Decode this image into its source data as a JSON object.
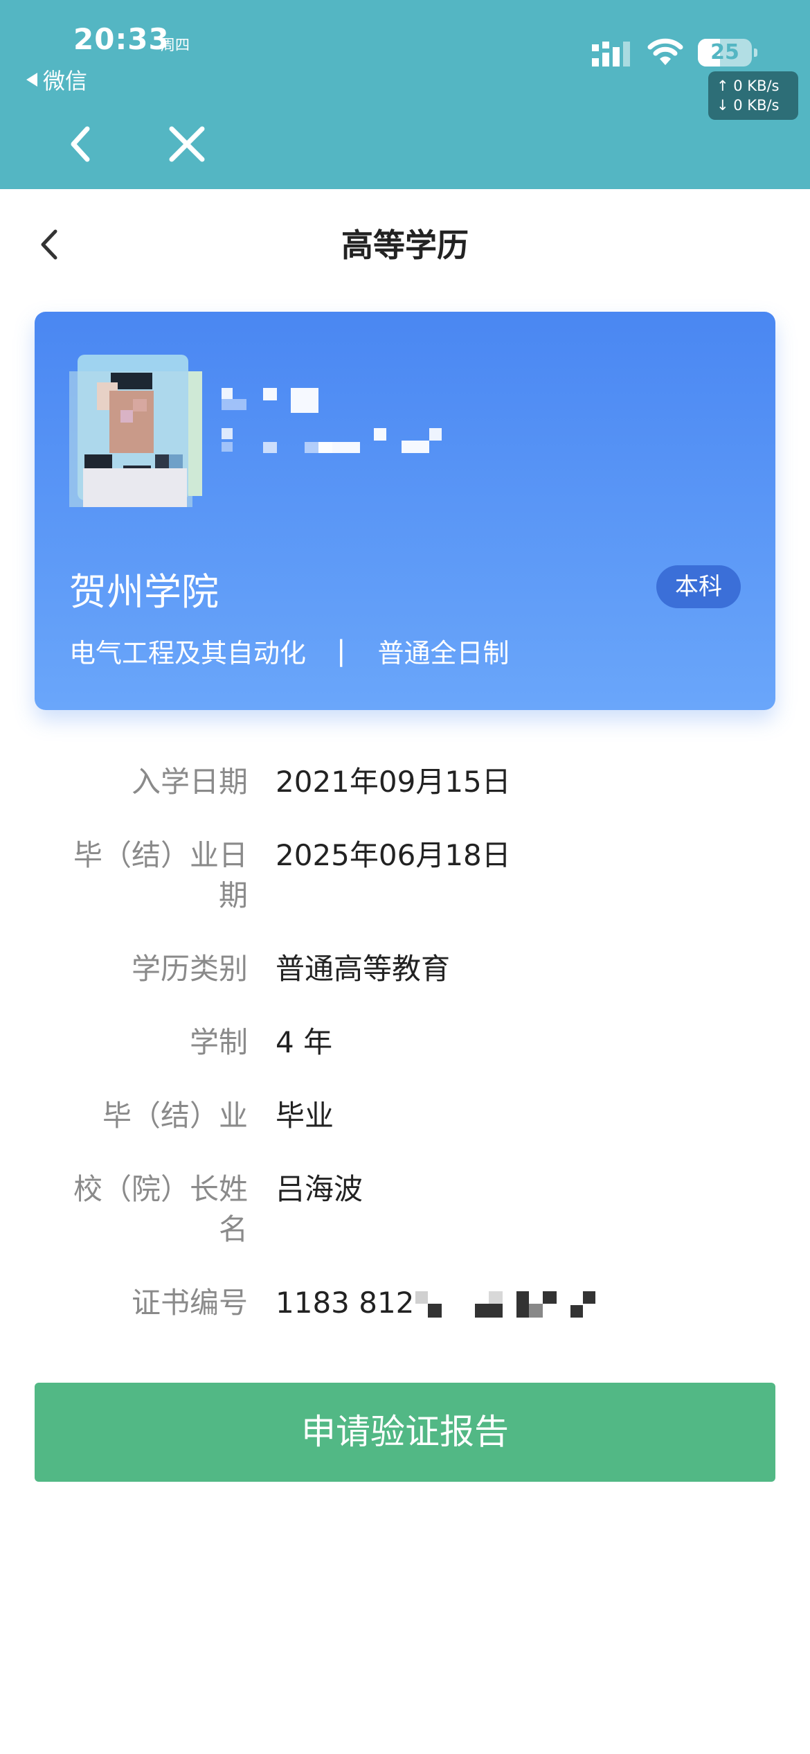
{
  "status_bar": {
    "time": "20:33",
    "weekday": "周四",
    "back_app": "微信",
    "battery": "25",
    "upload_speed": "↑ 0 KB/s",
    "download_speed": "↓ 0 KB/s"
  },
  "colors": {
    "header_bg": "#54b6c3",
    "card_gradient_top": "#4a87f2",
    "card_gradient_bottom": "#6aa6fa",
    "badge_bg": "#3b6fd8",
    "button_bg": "#52b885"
  },
  "header": {
    "title": "高等学历"
  },
  "card": {
    "school": "贺州学院",
    "level": "本科",
    "major": "电气工程及其自动化",
    "separator": "|",
    "study_mode": "普通全日制"
  },
  "info_rows": [
    {
      "label": "入学日期",
      "value": "2021年09月15日"
    },
    {
      "label": "毕（结）业日期",
      "value": "2025年06月18日"
    },
    {
      "label": "学历类别",
      "value": "普通高等教育"
    },
    {
      "label": "学制",
      "value": "4 年"
    },
    {
      "label": "毕（结）业",
      "value": "毕业"
    },
    {
      "label": "校（院）长姓名",
      "value": "吕海波"
    },
    {
      "label": "证书编号",
      "value": "1183 812"
    }
  ],
  "button": {
    "label": "申请验证报告"
  }
}
